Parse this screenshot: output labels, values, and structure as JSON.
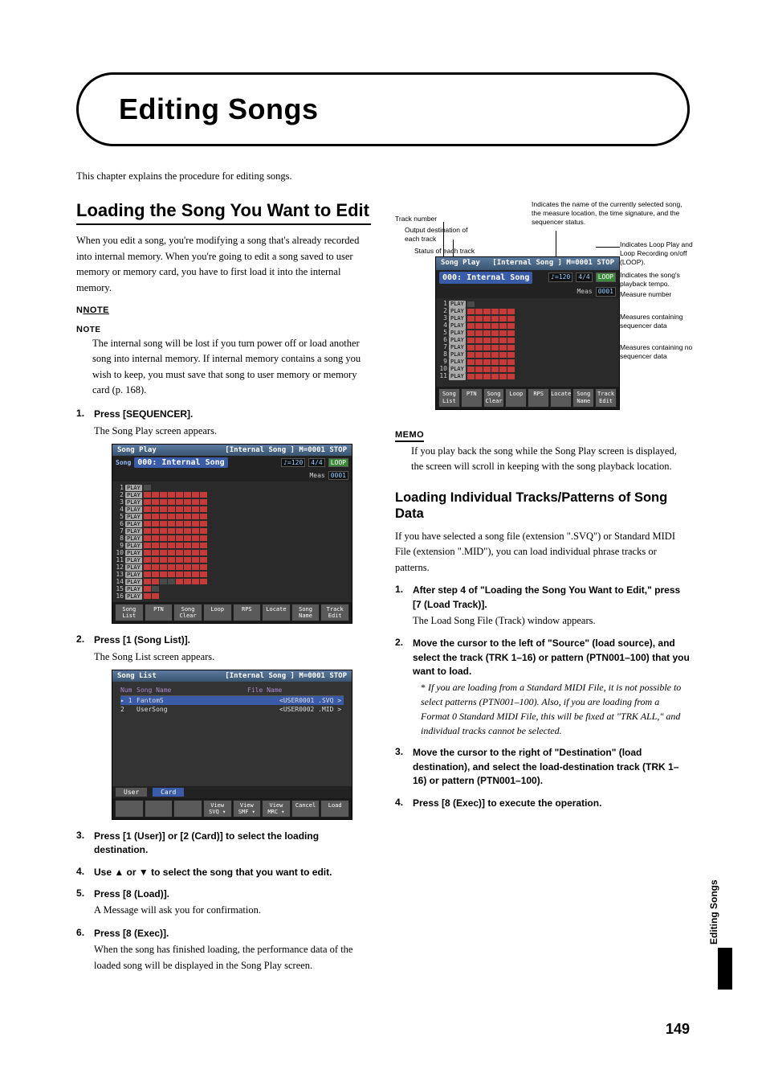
{
  "chapter": {
    "title": "Editing Songs"
  },
  "intro": "This chapter explains the procedure for editing songs.",
  "left": {
    "h2": "Loading the Song You Want to Edit",
    "intro": "When you edit a song, you're modifying a song that's already recorded into internal memory. When you're going to edit a song saved to user memory or memory card, you have to first load it into the internal memory.",
    "note_label": "NOTE",
    "note": "The internal song will be lost if you turn power off or load another song into internal memory. If internal memory contains a song you wish to keep, you must save that song to user memory or memory card (p. 168).",
    "steps": {
      "s1_head": "Press [SEQUENCER].",
      "s1_body": "The Song Play screen appears.",
      "s2_head": "Press [1 (Song List)].",
      "s2_body": "The Song List screen appears.",
      "s3_head": "Press [1 (User)] or [2 (Card)] to select the loading destination.",
      "s4_head": "Use ▲ or ▼ to select the song that you want to edit.",
      "s5_head": "Press [8 (Load)].",
      "s5_body": "A Message will ask you for confirmation.",
      "s6_head": "Press [8 (Exec)].",
      "s6_body": "When the song has finished loading, the performance data of the loaded song will be displayed in the Song Play screen."
    }
  },
  "right": {
    "diag": {
      "track_number": "Track number",
      "output_dest": "Output destination of each track",
      "status_each": "Status of each track",
      "indicates_name": "Indicates the name of the currently selected song, the measure location, the time signature, and the sequencer status.",
      "loop_play": "Indicates Loop Play and Loop Recording on/off (LOOP).",
      "playback_tempo": "Indicates the song's playback tempo.",
      "measure_number": "Measure number",
      "meas_contain": "Measures containing sequencer data",
      "meas_nocontain": "Measures containing no sequencer data"
    },
    "memo_label": "MEMO",
    "memo": "If you play back the song while the Song Play screen is displayed, the screen will scroll in keeping with the song playback location.",
    "h3": "Loading Individual Tracks/Patterns of Song Data",
    "body": "If you have selected a song file (extension \".SVQ\") or Standard MIDI File (extension \".MID\"), you can load individual phrase tracks or patterns.",
    "steps": {
      "s1_head": "After step 4 of \"Loading the Song You Want to Edit,\" press [7 (Load Track)].",
      "s1_body": "The Load Song File (Track) window appears.",
      "s2_head": "Move the cursor to the left of \"Source\" (load source), and select the track (TRK 1–16) or pattern (PTN001–100) that you want to load.",
      "s2_note": "If you are loading from a Standard MIDI File, it is not possible to select patterns (PTN001–100). Also, if you are loading from a Format 0 Standard MIDI File, this will be fixed at \"TRK ALL,\" and individual tracks cannot be selected.",
      "s3_head": "Move the cursor to the right of \"Destination\" (load destination), and select the load-destination track (TRK 1–16) or pattern (PTN001–100).",
      "s4_head": "Press [8 (Exec)] to execute the operation."
    }
  },
  "screenshot1": {
    "title_left": "Song Play",
    "title_right": "[Internal Song ] M=0001  STOP",
    "song_prefix": "Song",
    "song_num": "000:",
    "song_name": "Internal Song",
    "tempo": "♪=120",
    "sig": "4/4",
    "loop": "LOOP",
    "meas_label": "Meas",
    "meas_val": "0001",
    "btns": [
      "Song List",
      "PTN",
      "Song Clear",
      "Loop",
      "RPS",
      "Locate",
      "Song Name",
      "Track Edit"
    ]
  },
  "screenshot2": {
    "title_left": "Song List",
    "title_right": "[Internal Song ] M=0001  STOP",
    "col_num": "Num",
    "col_name": "Song Name",
    "col_file": "File Name",
    "row1_num": "1",
    "row1_name": "FantomS",
    "row1_file": "<USER0001    .SVQ >",
    "row2_num": "2",
    "row2_name": "UserSong",
    "row2_file": "<USER0002    .MID >",
    "tab_user": "User",
    "tab_card": "Card",
    "btns": [
      "",
      "",
      "",
      "View SVQ ▾",
      "View SMF ▾",
      "View MRC ▾",
      "Cancel",
      "Load"
    ]
  },
  "sidetab": "Editing Songs",
  "page_number": "149"
}
